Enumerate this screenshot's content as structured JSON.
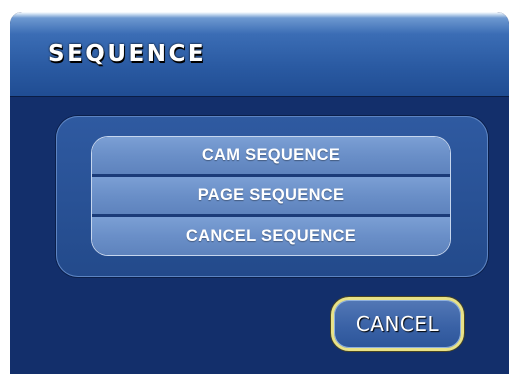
{
  "dialog": {
    "title": "SEQUENCE"
  },
  "menu": {
    "items": [
      {
        "label": "CAM SEQUENCE"
      },
      {
        "label": "PAGE SEQUENCE"
      },
      {
        "label": "CANCEL SEQUENCE"
      }
    ]
  },
  "footer": {
    "cancel_label": "CANCEL"
  },
  "colors": {
    "background": "#132f6b",
    "title_bar": "#2a5aa2",
    "menu_item": "#6a8fc8",
    "focus_border": "#e8e288",
    "text": "#ffffff"
  }
}
